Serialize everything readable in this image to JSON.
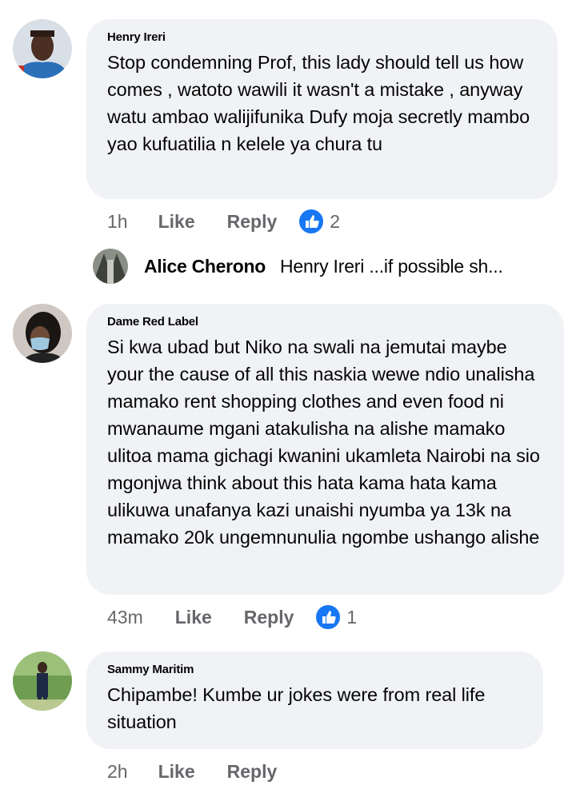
{
  "comments": [
    {
      "author": "Henry Ireri",
      "text": "Stop condemning Prof, this lady should tell us how comes , watoto wawili it wasn't a mistake , anyway watu ambao walijifunika Dufy moja secretly mambo yao kufuatilia n kelele ya chura tu",
      "time": "1h",
      "like_label": "Like",
      "reply_label": "Reply",
      "reaction_icon": "like-reaction-icon",
      "reaction_count": "2"
    },
    {
      "author": "Dame Red Label",
      "text": "Si kwa ubad but Niko na swali na jemutai maybe your the cause of all this naskia wewe ndio unalisha mamako rent shopping clothes and even food ni mwanaume mgani atakulisha na alishe mamako ulitoa mama gichagi kwanini ukamleta Nairobi na sio mgonjwa think about this hata kama hata kama ulikuwa unafanya kazi unaishi nyumba ya 13k na mamako 20k ungemnunulia ngombe ushango alishe",
      "time": "43m",
      "like_label": "Like",
      "reply_label": "Reply",
      "reaction_icon": "like-reaction-icon",
      "reaction_count": "1"
    },
    {
      "author": "Sammy Maritim",
      "text": "Chipambe! Kumbe ur jokes were from real life situation",
      "time": "2h",
      "like_label": "Like",
      "reply_label": "Reply"
    }
  ],
  "reply_preview": {
    "author": "Alice Cherono",
    "text": "Henry Ireri ...if possible sh..."
  },
  "colors": {
    "bubble": "#f0f2f5",
    "meta_text": "#65676b",
    "like_blue": "#1877f2"
  }
}
